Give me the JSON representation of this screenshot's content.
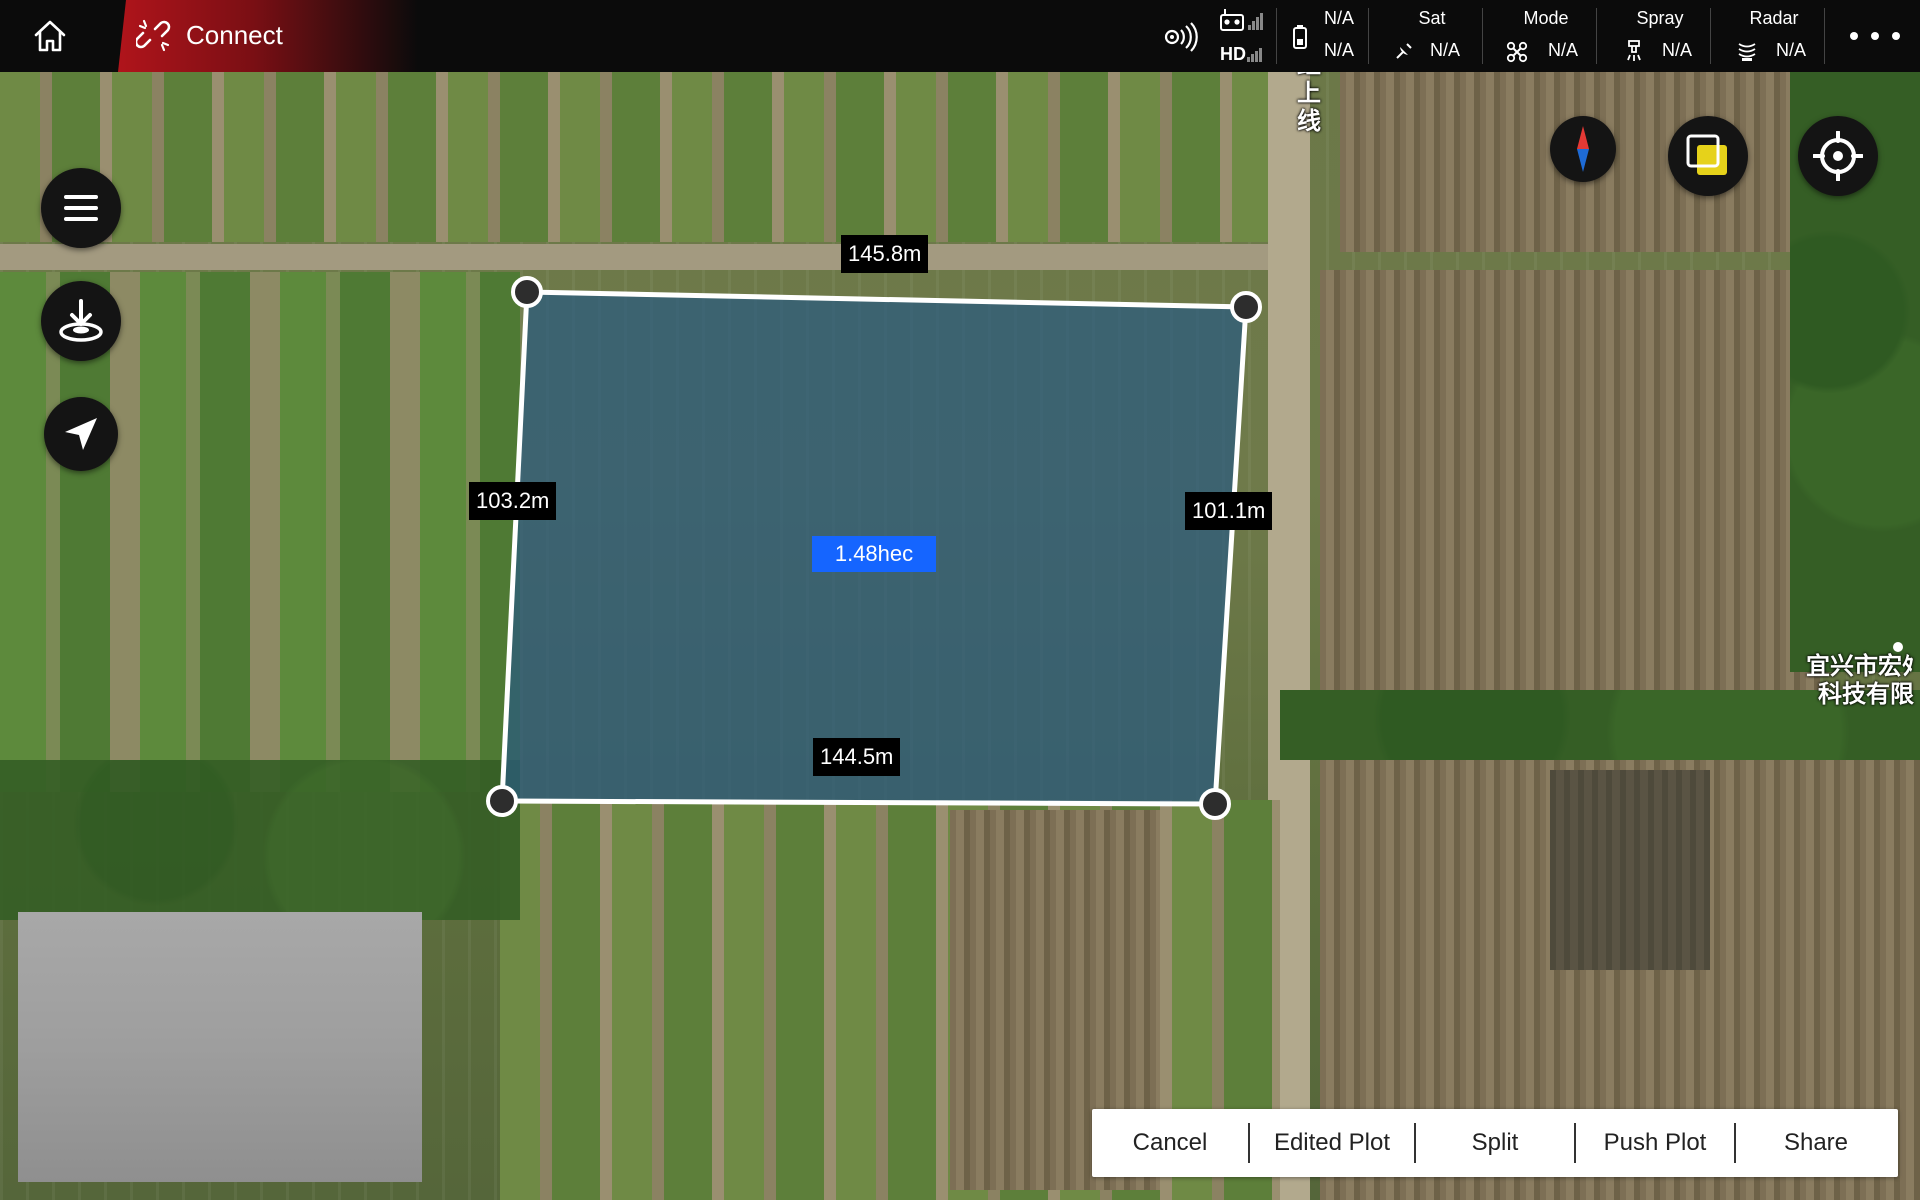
{
  "topbar": {
    "home_icon": "home-icon",
    "connect_label": "Connect",
    "signal_icon": "signal-icon",
    "remote": {
      "rc_icon": "remote-controller-icon",
      "hd_label": "HD"
    },
    "battery": {
      "top_value": "N/A",
      "bottom_value": "N/A"
    },
    "sat": {
      "label": "Sat",
      "value": "N/A"
    },
    "mode": {
      "label": "Mode",
      "value": "N/A"
    },
    "spray": {
      "label": "Spray",
      "value": "N/A"
    },
    "radar": {
      "label": "Radar",
      "value": "N/A"
    },
    "more_icon": "more-icon"
  },
  "plot": {
    "top_edge": "145.8m",
    "left_edge": "103.2m",
    "right_edge": "101.1m",
    "bottom_edge": "144.5m",
    "area": "1.48hec"
  },
  "map_labels": {
    "road_name_chars": [
      "红",
      "上",
      "线"
    ],
    "company_line1": "宜兴市宏ﾀ",
    "company_line2": "科技有限"
  },
  "actions": {
    "cancel": "Cancel",
    "edited_plot": "Edited Plot",
    "split": "Split",
    "push_plot": "Push Plot",
    "share": "Share"
  },
  "colors": {
    "brand_red": "#b0141b",
    "area_blue": "#1565ff",
    "plot_fill": "#2a5a80",
    "compass_red": "#e53935",
    "compass_blue": "#1e6bd6",
    "layer_yellow": "#e6d21a"
  }
}
